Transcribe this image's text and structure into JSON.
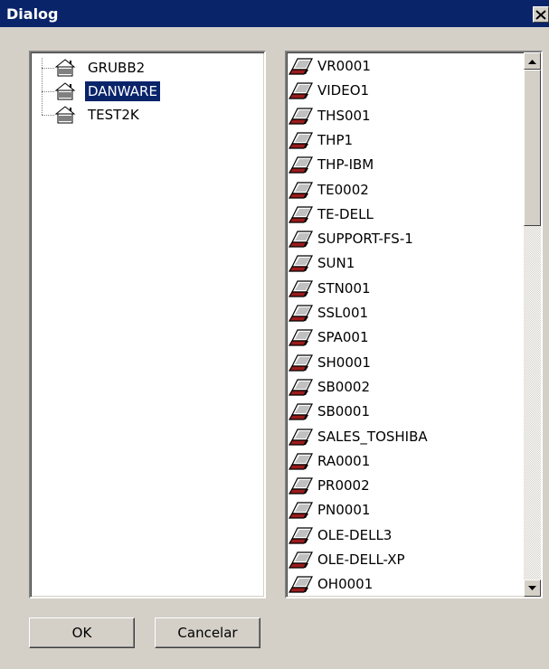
{
  "window": {
    "title": "Dialog"
  },
  "tree": {
    "items": [
      {
        "label": "GRUBB2",
        "selected": false
      },
      {
        "label": "DANWARE",
        "selected": true
      },
      {
        "label": "TEST2K",
        "selected": false
      }
    ]
  },
  "computers": {
    "items": [
      "VR0001",
      "VIDEO1",
      "THS001",
      "THP1",
      "THP-IBM",
      "TE0002",
      "TE-DELL",
      "SUPPORT-FS-1",
      "SUN1",
      "STN001",
      "SSL001",
      "SPA001",
      "SH0001",
      "SB0002",
      "SB0001",
      "SALES_TOSHIBA",
      "RA0001",
      "PR0002",
      "PN0001",
      "OLE-DELL3",
      "OLE-DELL-XP",
      "OH0001"
    ]
  },
  "buttons": {
    "ok": "OK",
    "cancel": "Cancelar"
  },
  "colors": {
    "selection": "#0a246a",
    "face": "#d4d0c8",
    "title_bar": "#0a246a"
  },
  "icons": {
    "tree_node": "workgroup-house-icon",
    "list_item": "laptop-computer-icon"
  }
}
